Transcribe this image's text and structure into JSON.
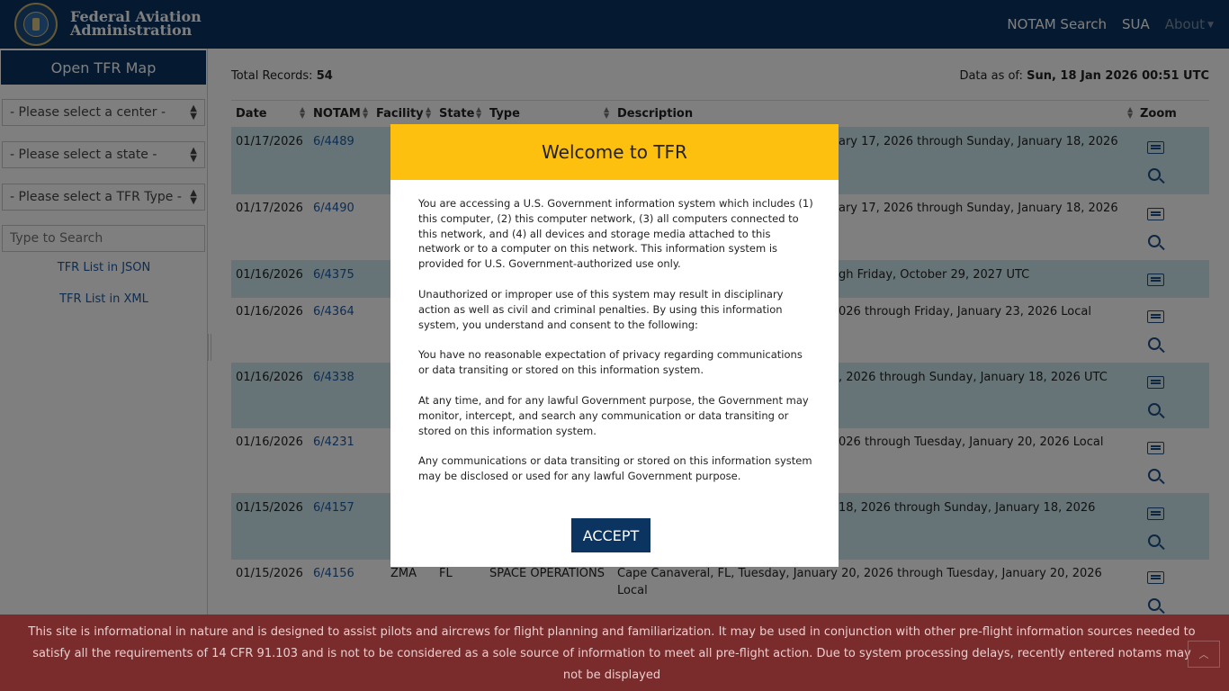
{
  "header": {
    "agency_line1": "Federal Aviation",
    "agency_line2": "Administration",
    "logo_icon": "faa-seal-icon",
    "nav": [
      "NOTAM Search",
      "SUA",
      "About"
    ]
  },
  "sidebar": {
    "open_map": "Open TFR Map",
    "center_select": "- Please select a center -",
    "state_select": "- Please select a state -",
    "type_select": "- Please select a TFR Type -",
    "search_placeholder": "Type to Search",
    "link_json": "TFR List in JSON",
    "link_xml": "TFR List in XML"
  },
  "summary": {
    "total_label": "Total Records:",
    "total_value": "54",
    "asof_label": "Data as of:",
    "asof_value": "Sun, 18 Jan 2026 00:51 UTC"
  },
  "table": {
    "headers": [
      "Date",
      "NOTAM",
      "Facility",
      "State",
      "Type",
      "Description",
      "Zoom"
    ],
    "rows": [
      {
        "date": "01/17/2026",
        "notam": "6/4489",
        "facility": "",
        "state": "",
        "type": "",
        "desc": "ary 17, 2026 through Sunday, January 18, 2026"
      },
      {
        "date": "01/17/2026",
        "notam": "6/4490",
        "facility": "",
        "state": "",
        "type": "",
        "desc": "ary 17, 2026 through Sunday, January 18, 2026"
      },
      {
        "date": "01/16/2026",
        "notam": "6/4375",
        "facility": "",
        "state": "",
        "type": "",
        "desc": "gh Friday, October 29, 2027 UTC"
      },
      {
        "date": "01/16/2026",
        "notam": "6/4364",
        "facility": "",
        "state": "",
        "type": "",
        "desc": "026 through Friday, January 23, 2026 Local"
      },
      {
        "date": "01/16/2026",
        "notam": "6/4338",
        "facility": "",
        "state": "",
        "type": "",
        "desc": ", 2026 through Sunday, January 18, 2026 UTC"
      },
      {
        "date": "01/16/2026",
        "notam": "6/4231",
        "facility": "",
        "state": "",
        "type": "",
        "desc": "026 through Tuesday, January 20, 2026 Local"
      },
      {
        "date": "01/15/2026",
        "notam": "6/4157",
        "facility": "",
        "state": "",
        "type": "",
        "desc": " 18, 2026 through Sunday, January 18, 2026"
      },
      {
        "date": "01/15/2026",
        "notam": "6/4156",
        "facility": "ZMA",
        "state": "FL",
        "type": "SPACE OPERATIONS",
        "desc": "Cape Canaveral, FL, Tuesday, January 20, 2026 through Tuesday, January 20, 2026 Local"
      }
    ]
  },
  "modal": {
    "title": "Welcome to TFR",
    "paragraphs": [
      "You are accessing a U.S. Government information system which includes (1) this computer, (2) this computer network, (3) all computers connected to this network, and (4) all devices and storage media attached to this network or to a computer on this network. This information system is provided for U.S. Government-authorized use only.",
      "Unauthorized or improper use of this system may result in disciplinary action as well as civil and criminal penalties. By using this information system, you understand and consent to the following:",
      "You have no reasonable expectation of privacy regarding communications or data transiting or stored on this information system.",
      "At any time, and for any lawful Government purpose, the Government may monitor, intercept, and search any communication or data transiting or stored on this information system.",
      "Any communications or data transiting or stored on this information system may be disclosed or used for any lawful Government purpose."
    ],
    "accept_label": "ACCEPT"
  },
  "footer": {
    "disclaimer": "This site is informational in nature and is designed to assist pilots and aircrews for flight planning and familiarization. It may be used in conjunction with other pre-flight information sources needed to satisfy all the requirements of 14 CFR 91.103 and is not to be considered as a sole source of information to meet all pre-flight action. Due to system processing delays, recently entered notams may not be displayed",
    "to_top_icon": "chevron-up-icon"
  },
  "colors": {
    "navy": "#0b3461",
    "modal_header": "#fdc00f",
    "row_alt": "#cfe8ee",
    "disclaimer_bg": "#7a2b2c",
    "link": "#1a5aa6"
  }
}
